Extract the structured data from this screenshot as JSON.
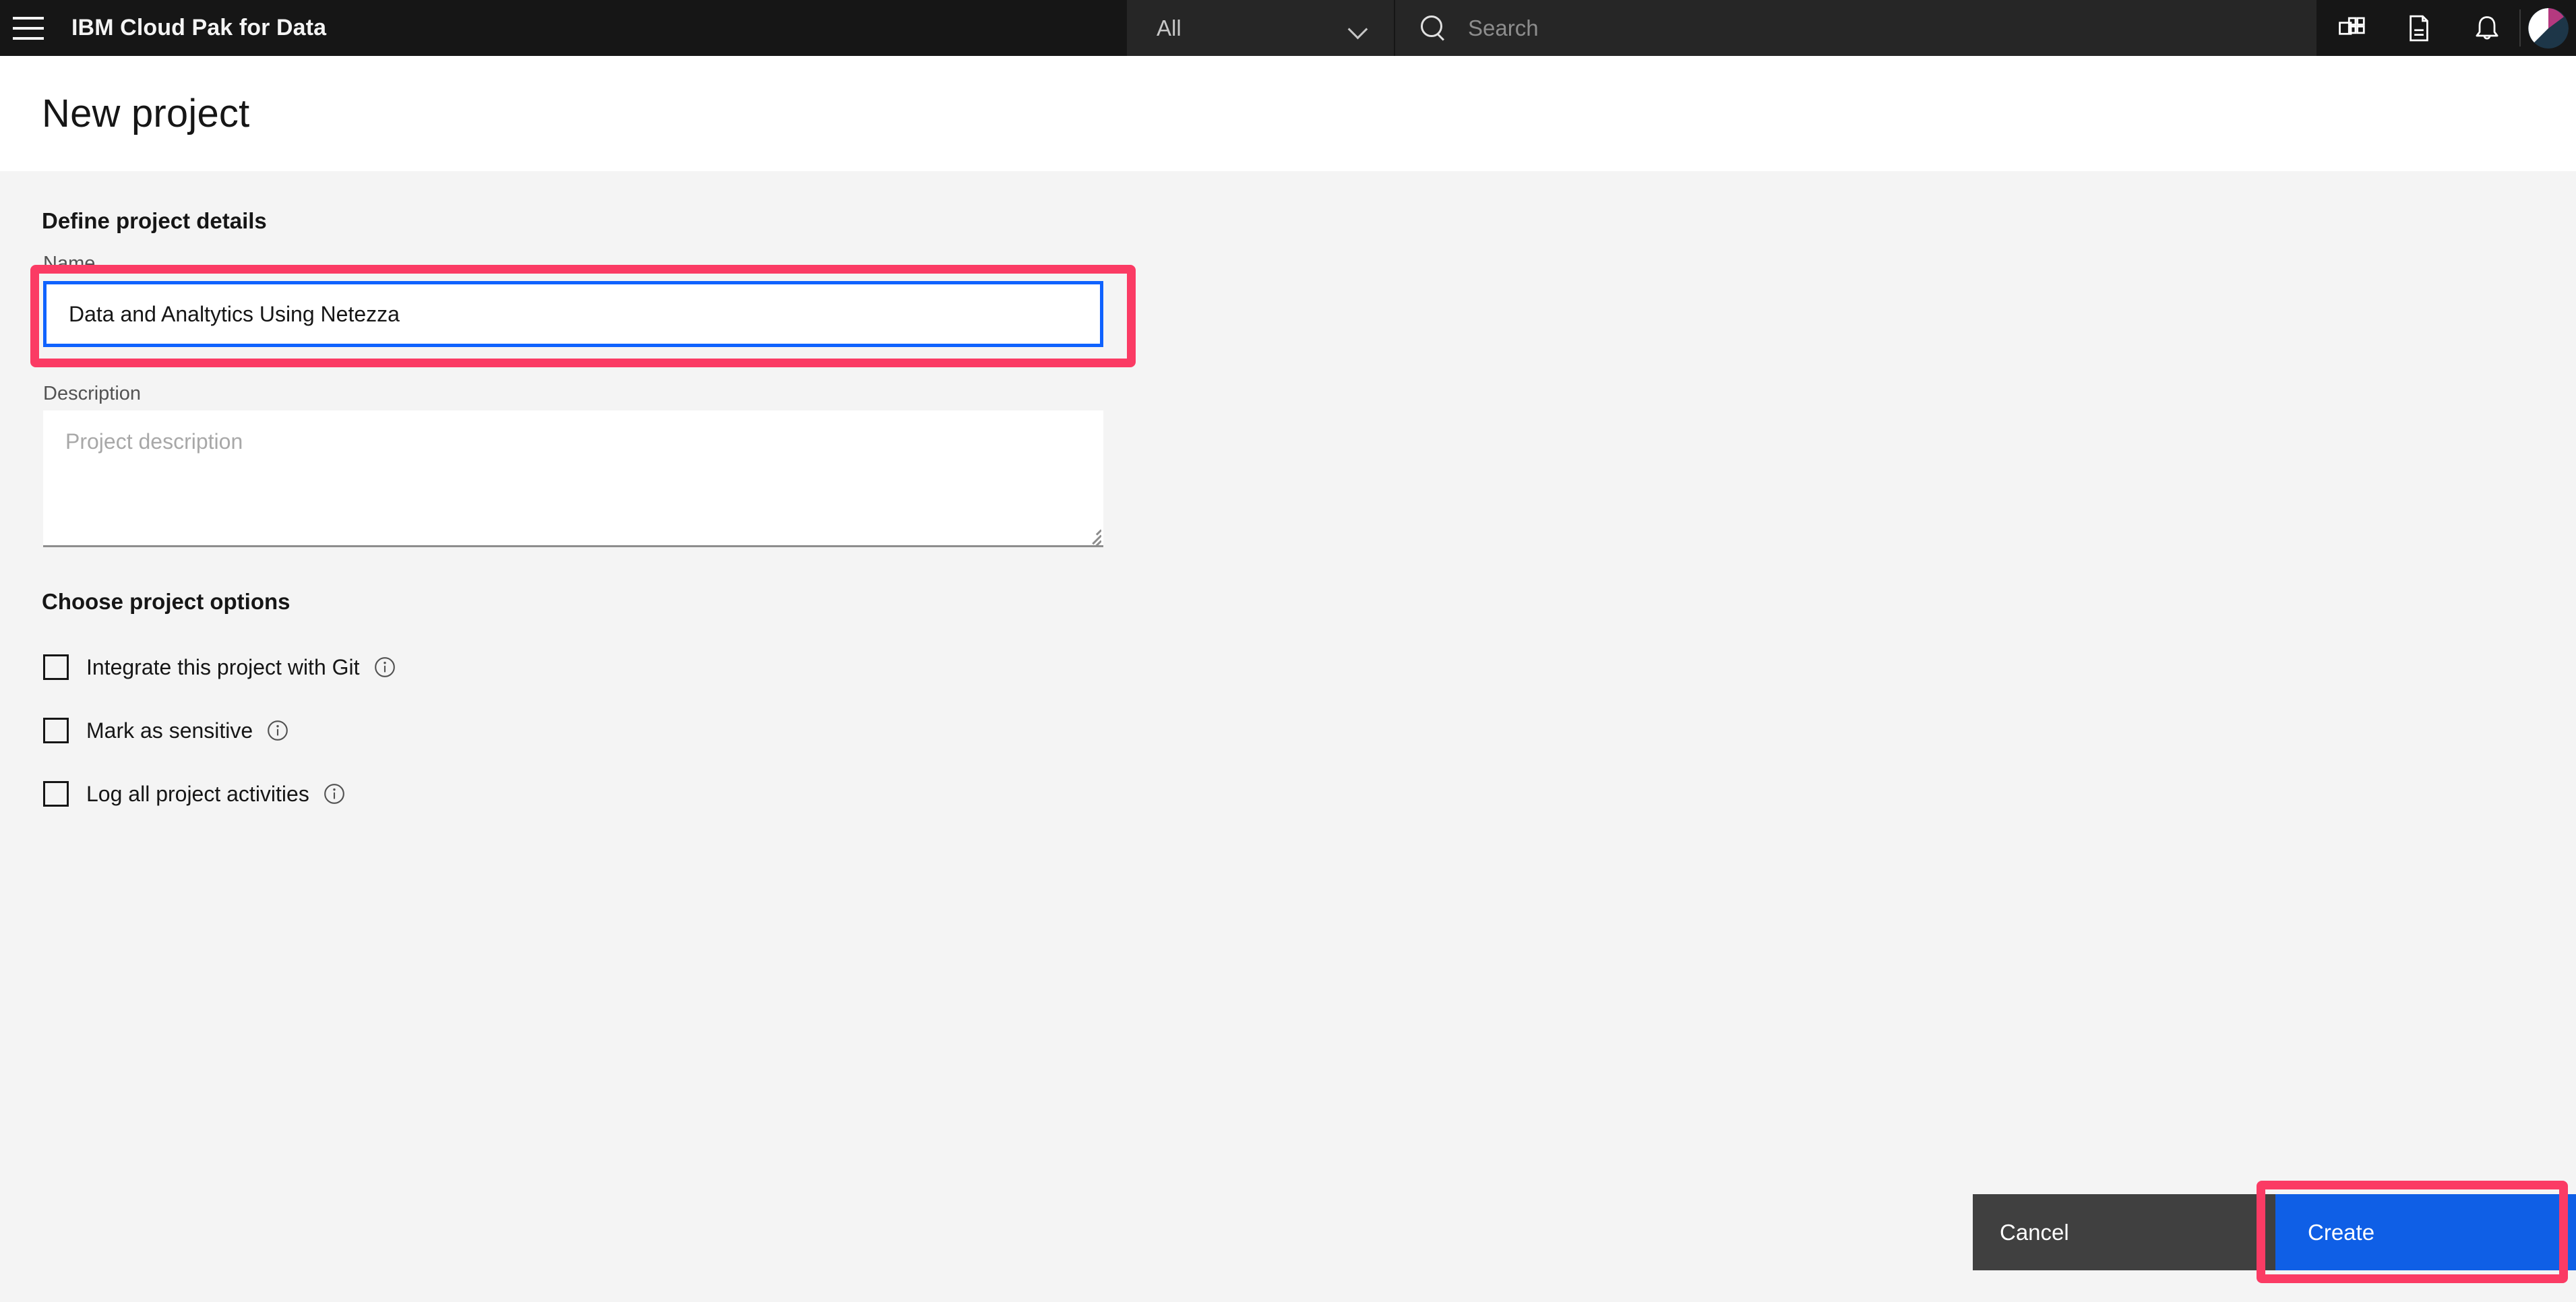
{
  "header": {
    "menu_icon": "hamburger-icon",
    "brand_title": "IBM Cloud Pak for Data",
    "scope_value": "All",
    "scope_chevron_icon": "chevron-down-icon",
    "search_icon": "search-icon",
    "search_placeholder": "Search",
    "search_value": "",
    "icons": [
      {
        "name": "app-switcher-icon"
      },
      {
        "name": "document-icon"
      },
      {
        "name": "notification-bell-icon"
      }
    ],
    "avatar_name": "user-avatar",
    "avatar_colors": {
      "magenta": "#b4397f",
      "white": "#ffffff",
      "navy": "#1d3648"
    }
  },
  "page": {
    "title": "New project"
  },
  "form": {
    "details_heading": "Define project details",
    "name_label": "Name",
    "name_value": "Data and Analtytics Using Netezza",
    "description_label": "Description",
    "description_value": "",
    "description_placeholder": "Project description",
    "options_heading": "Choose project options",
    "options": [
      {
        "label": "Integrate this project with Git",
        "checked": false,
        "info_icon": "info-icon"
      },
      {
        "label": "Mark as sensitive",
        "checked": false,
        "info_icon": "info-icon"
      },
      {
        "label": "Log all project activities",
        "checked": false,
        "info_icon": "info-icon"
      }
    ]
  },
  "actions": {
    "cancel_label": "Cancel",
    "create_label": "Create"
  },
  "colors": {
    "header_bg": "#161616",
    "content_bg": "#f4f4f4",
    "focus_blue": "#0f62fe",
    "primary_blue": "#0f5fe6",
    "cancel_gray": "#404040",
    "highlight_pink": "#fb3b64"
  }
}
